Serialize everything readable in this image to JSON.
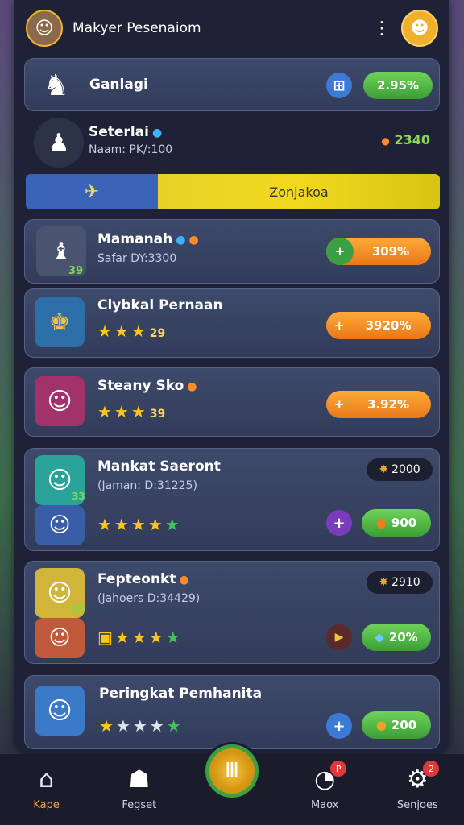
{
  "header": {
    "title": "Makyer Pesenaiom",
    "menu_icon": "⋮"
  },
  "top_card": {
    "name": "Ganlagi",
    "action_icon": "⊞",
    "pill_value": "2.95%"
  },
  "player": {
    "name": "Seterlai",
    "sub": "Naam: PK/:100",
    "score": "2340"
  },
  "segment": {
    "left_icon": "✈",
    "active_label": "Zonjakoa"
  },
  "cards": [
    {
      "name": "Mamanah",
      "sub": "Safar DY:3300",
      "level": "39",
      "pill": "309%",
      "pill_icon": "+"
    },
    {
      "name": "Clybkal Pernaan",
      "stars": [
        1,
        1,
        1
      ],
      "level": "29",
      "pill": "3920%",
      "pill_icon": "+"
    },
    {
      "name": "Steany Sko",
      "stars": [
        1,
        1,
        1
      ],
      "level": "39",
      "pill": "3.92%",
      "pill_icon": "+"
    },
    {
      "name": "Mankat Saeront",
      "sub": "(Jaman: D:31225)",
      "badge": "2000",
      "level": "33",
      "pill": "900",
      "pill_icon": "+"
    },
    {
      "name": "Fepteonkt",
      "sub": "(Jahoers D:34429)",
      "badge": "2910",
      "level": "33",
      "pill": "20%",
      "pill_icon": "▶"
    },
    {
      "name": "Peringkat Pemhanita",
      "pill": "200",
      "pill_icon": "+"
    }
  ],
  "tabs": [
    {
      "label": "Kape",
      "icon": "⌂"
    },
    {
      "label": "Fegset",
      "icon": "☗"
    },
    {
      "label": "Maox",
      "icon": "◔",
      "notif": "P"
    },
    {
      "label": "Senjoes",
      "icon": "⚙",
      "notif": "2"
    }
  ],
  "center_icon": "Ⅲ",
  "colors": {
    "accent_green": "#3a9e35",
    "accent_orange": "#e87818",
    "accent_yellow": "#f1d81d",
    "panel": "#1f2236"
  }
}
